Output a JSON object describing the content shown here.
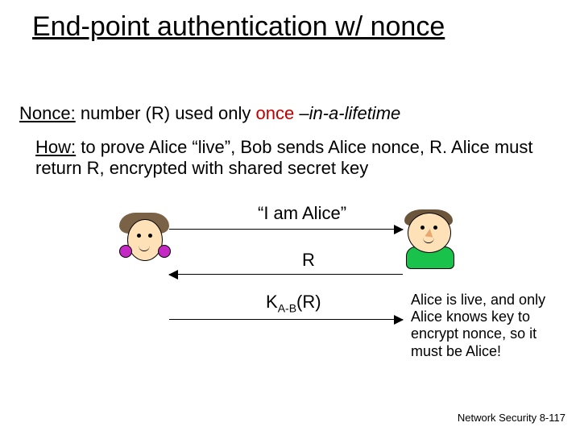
{
  "title": "End-point authentication w/ nonce",
  "nonce": {
    "label": "Nonce:",
    "part1": " number (R) used only ",
    "once": "once",
    "dash": " –",
    "tail": "in-a-lifetime"
  },
  "how": {
    "label": "How:",
    "text": " to prove Alice “live”, Bob sends Alice nonce, R.  Alice must return R, encrypted with shared secret key"
  },
  "messages": {
    "m1": "“I am Alice”",
    "m2": "R",
    "m3_K": "K",
    "m3_sub": "A-B",
    "m3_rest": "(R)"
  },
  "explain": "Alice is live, and only Alice knows key to encrypt nonce, so it must be Alice!",
  "footer": "Network Security   8-117",
  "actors": {
    "alice": "alice-character",
    "bob": "bob-character"
  }
}
